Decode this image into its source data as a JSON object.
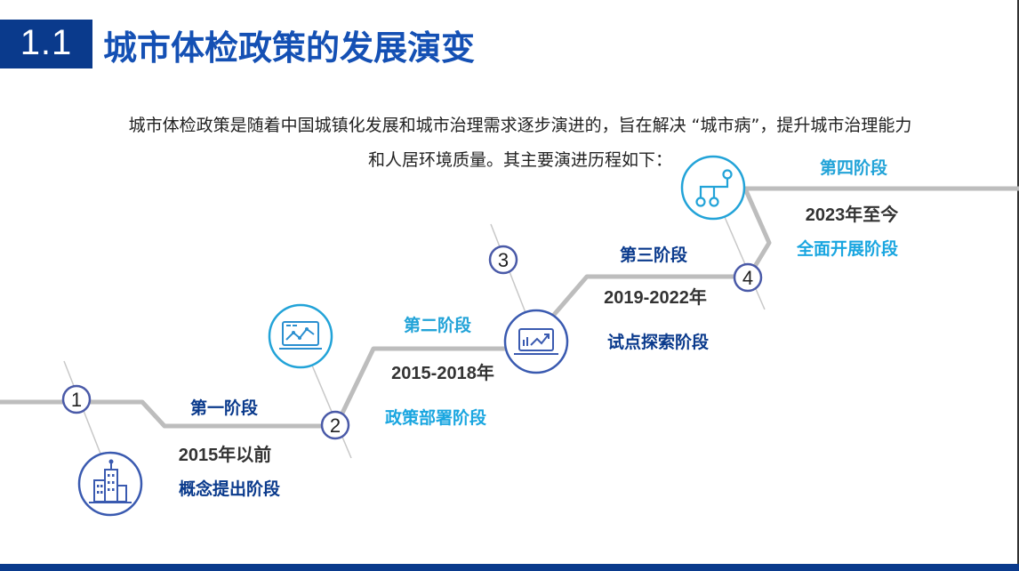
{
  "header": {
    "section_number": "1.1",
    "title": "城市体检政策的发展演变"
  },
  "intro": {
    "line1": "城市体检政策是随着中国城镇化发展和城市治理需求逐步演进的，旨在解决 “城市病”，提升城市治理能力",
    "line2": "和人居环境质量。其主要演进历程如下："
  },
  "stages": [
    {
      "number": "1",
      "name": "第一阶段",
      "period": "2015年以前",
      "description": "概念提出阶段",
      "icon": "city-buildings-icon"
    },
    {
      "number": "2",
      "name": "第二阶段",
      "period": "2015-2018年",
      "description": "政策部署阶段",
      "icon": "monitor-chart-icon"
    },
    {
      "number": "3",
      "name": "第三阶段",
      "period": "2019-2022年",
      "description": "试点探索阶段",
      "icon": "laptop-trend-icon"
    },
    {
      "number": "4",
      "name": "第四阶段",
      "period": "2023年至今",
      "description": "全面开展阶段",
      "icon": "network-branch-icon"
    }
  ],
  "colors": {
    "brand_dark": "#0a3a8c",
    "brand_blue": "#1450b4",
    "accent_cyan": "#22a3d8",
    "circle_stroke": "#4a5aa8",
    "icon_circle_stroke": "#3a5ab0",
    "step_line": "#bdbdbd"
  }
}
